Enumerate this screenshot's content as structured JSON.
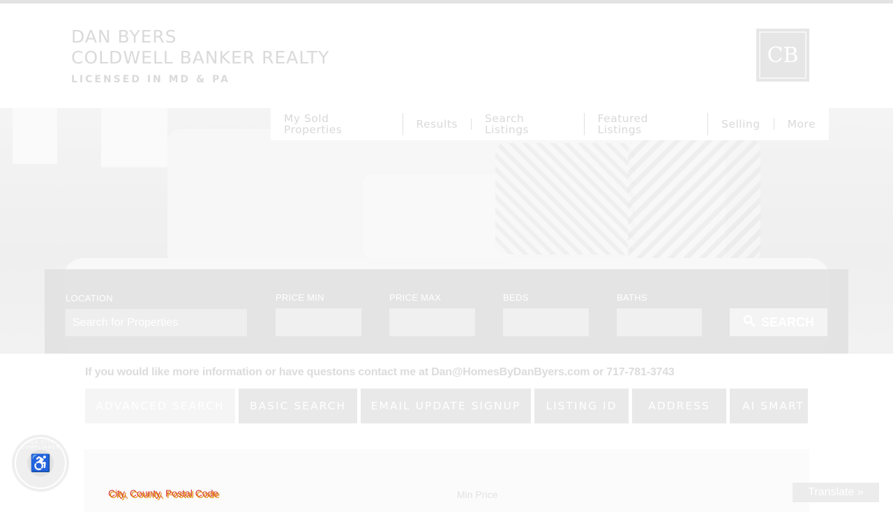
{
  "brand": {
    "name": "DAN BYERS",
    "company": "COLDWELL BANKER REALTY",
    "license": "LICENSED IN MD & PA",
    "logo_text": "CB"
  },
  "nav": {
    "items": [
      {
        "label": "My Sold Properties"
      },
      {
        "label": "Results"
      },
      {
        "label": "Search Listings"
      },
      {
        "label": "Featured Listings"
      },
      {
        "label": "Selling"
      },
      {
        "label": "More"
      }
    ]
  },
  "search": {
    "location_label": "LOCATION",
    "location_placeholder": "Search for Properties",
    "price_min_label": "PRICE MIN",
    "price_max_label": "PRICE MAX",
    "beds_label": "BEDS",
    "baths_label": "BATHS",
    "search_button": "SEARCH"
  },
  "contact": {
    "text": "If you would like more information or have questons contact me at Dan@HomesByDanByers.com or 717-781-3743"
  },
  "tabs": [
    {
      "label": "ADVANCED SEARCH",
      "active": true
    },
    {
      "label": "BASIC SEARCH",
      "active": false
    },
    {
      "label": "EMAIL UPDATE SIGNUP",
      "active": false
    },
    {
      "label": "LISTING ID",
      "active": false
    },
    {
      "label": "ADDRESS",
      "active": false
    },
    {
      "label": "AI SMART",
      "active": false
    }
  ],
  "panel": {
    "location_label": "City, County, Postal Code",
    "min_price_label": "Min Price"
  },
  "ada": {
    "badge_text": "ADA SITE COMPLIANCE"
  },
  "translate": {
    "label": "Translate »"
  },
  "colors": {
    "background": "#ffffff",
    "faded_text": "#d9d9d9",
    "search_bar": "#e1e1e1"
  }
}
